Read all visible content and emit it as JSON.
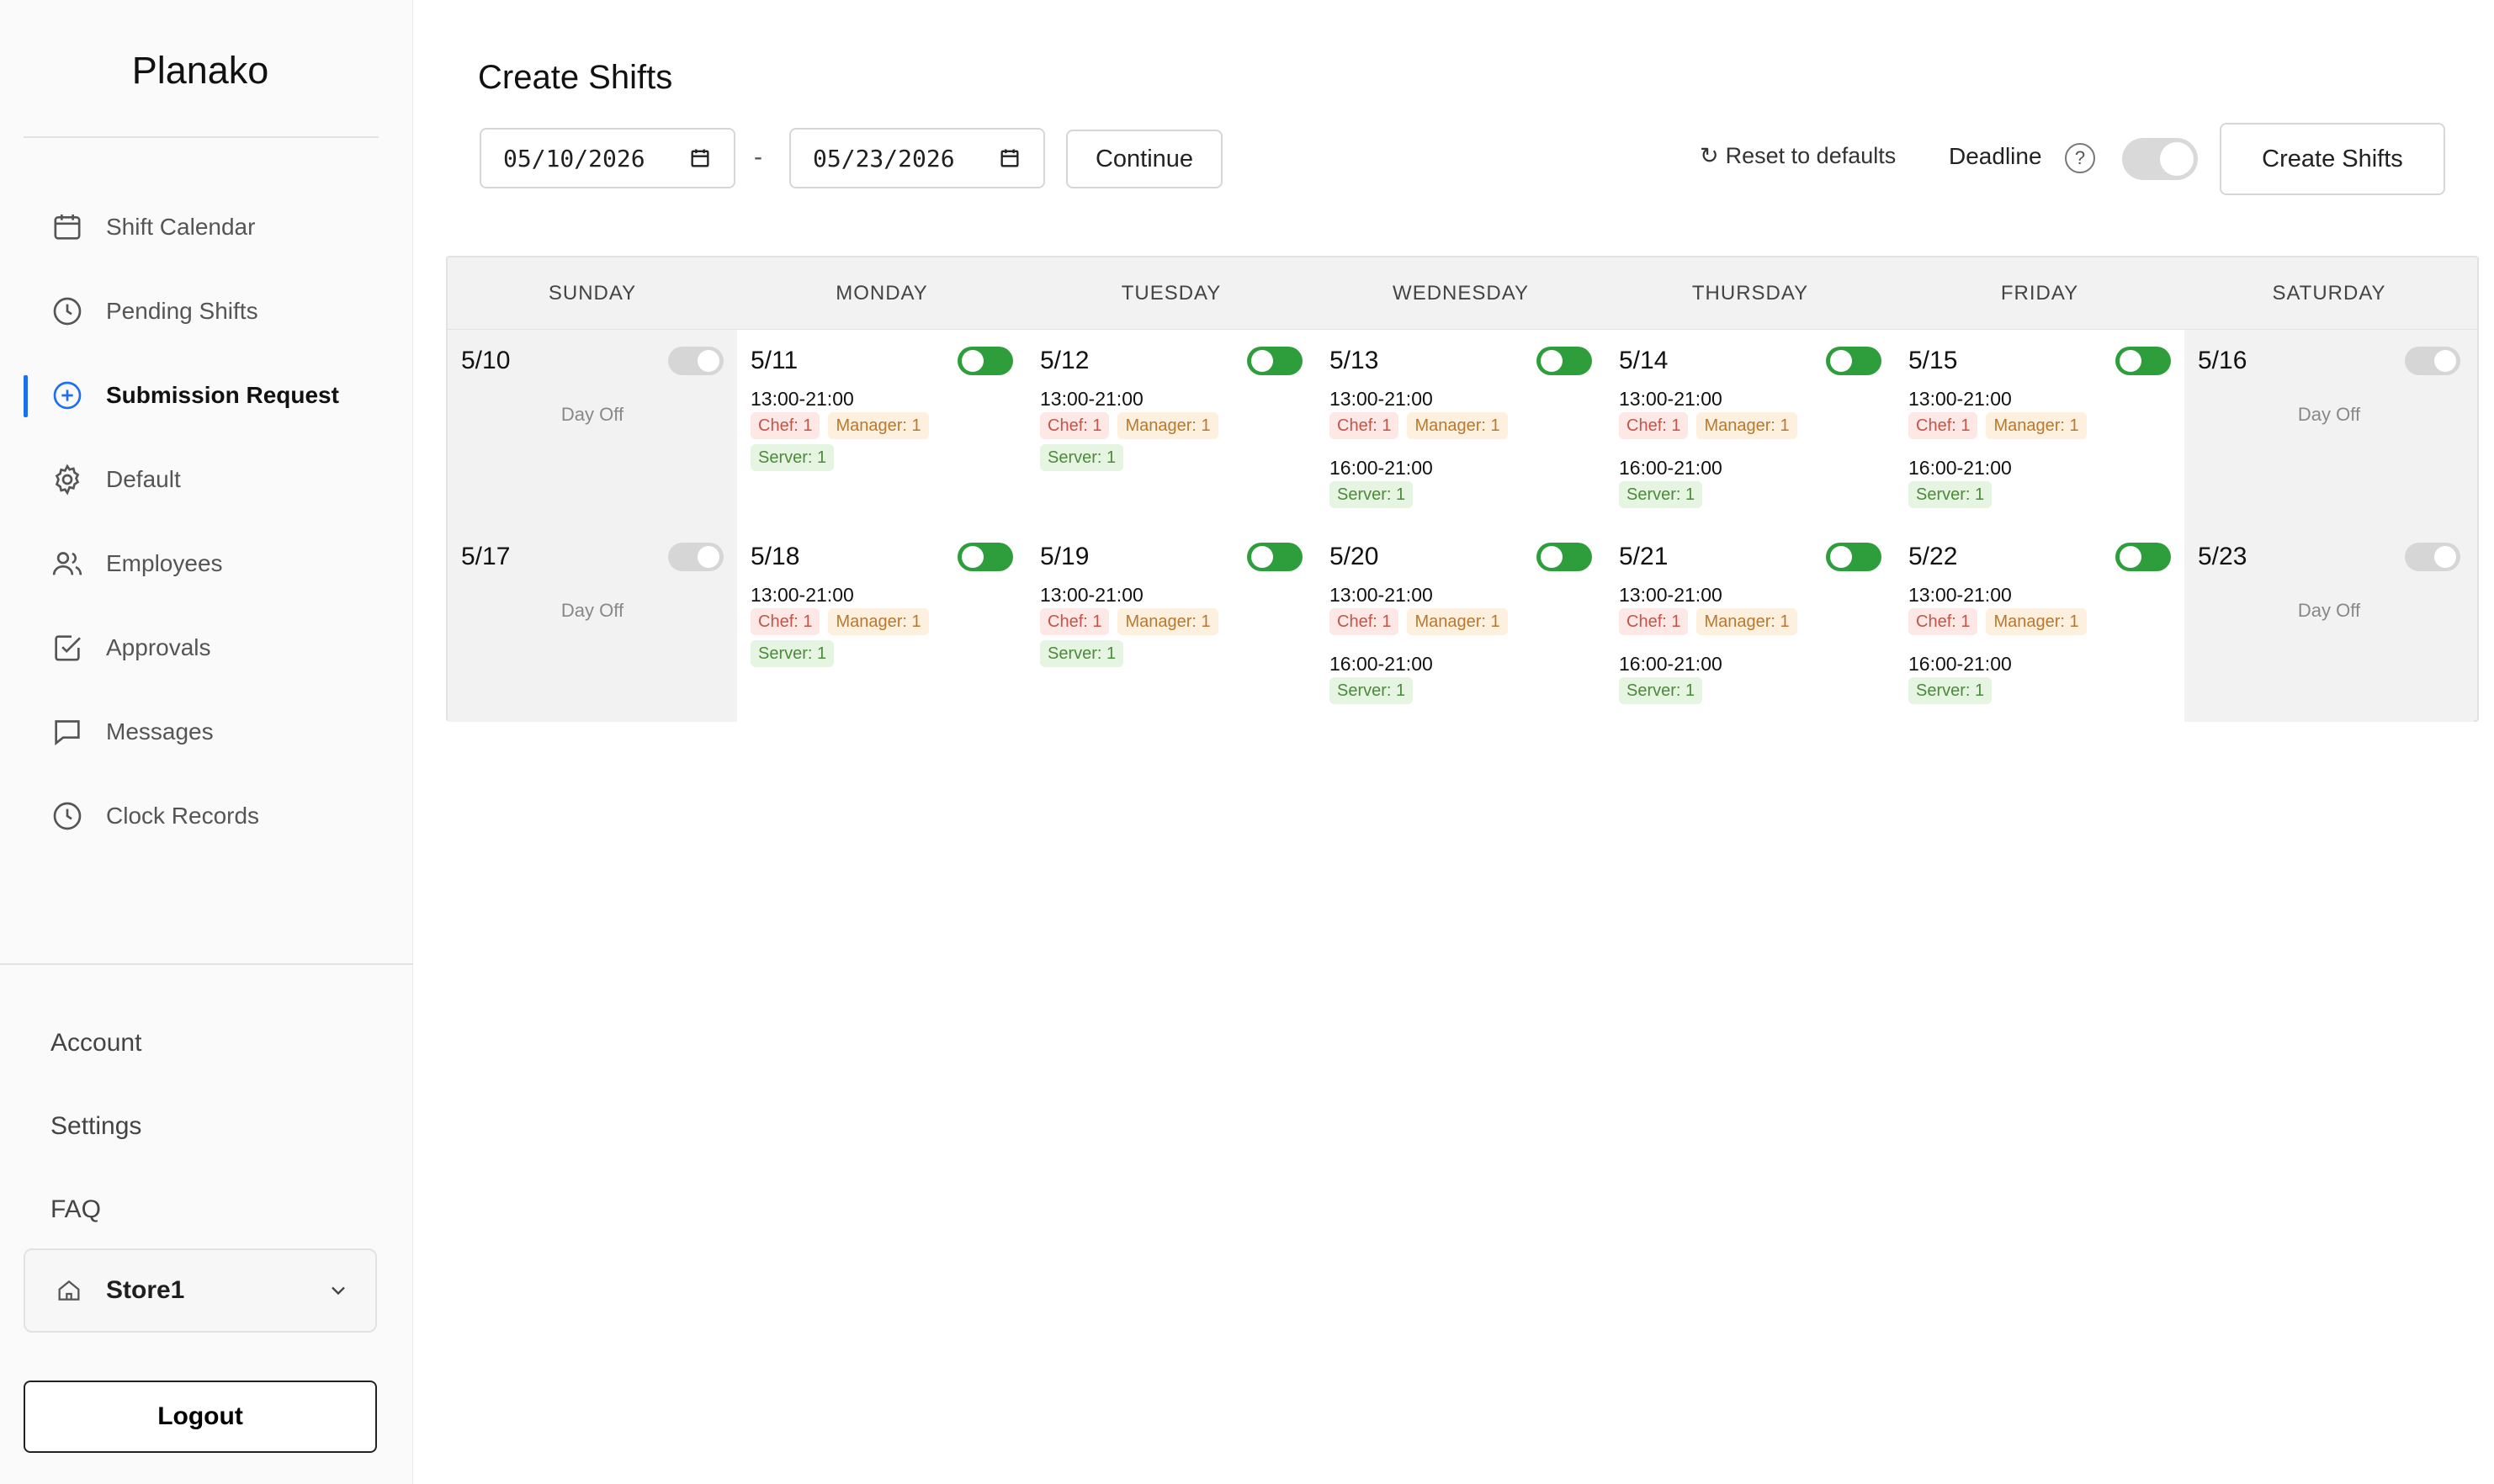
{
  "app": {
    "logo": "Planako"
  },
  "sidebar": {
    "nav": [
      {
        "label": "Shift Calendar",
        "icon": "calendar-icon",
        "active": false
      },
      {
        "label": "Pending Shifts",
        "icon": "clock-icon",
        "active": false
      },
      {
        "label": "Submission Request",
        "icon": "plus-circle-icon",
        "active": true
      },
      {
        "label": "Default",
        "icon": "gear-icon",
        "active": false
      },
      {
        "label": "Employees",
        "icon": "users-icon",
        "active": false
      },
      {
        "label": "Approvals",
        "icon": "checkbox-icon",
        "active": false
      },
      {
        "label": "Messages",
        "icon": "message-icon",
        "active": false
      },
      {
        "label": "Clock Records",
        "icon": "clock-icon",
        "active": false
      }
    ],
    "bottom_links": [
      "Account",
      "Settings",
      "FAQ"
    ],
    "store": {
      "label": "Store1",
      "icon": "home-icon"
    },
    "logout": "Logout"
  },
  "main": {
    "title": "Create Shifts",
    "start_date": "05/10/2026",
    "date_separator": "-",
    "end_date": "05/23/2026",
    "continue_label": "Continue",
    "reset_label": "Reset to defaults",
    "deadline_label": "Deadline",
    "help_symbol": "?",
    "deadline_enabled": false,
    "create_label": "Create Shifts"
  },
  "calendar": {
    "weekdays": [
      "SUNDAY",
      "MONDAY",
      "TUESDAY",
      "WEDNESDAY",
      "THURSDAY",
      "FRIDAY",
      "SATURDAY"
    ],
    "day_off_label": "Day Off",
    "weeks": [
      [
        {
          "date": "5/10",
          "enabled": false,
          "shifts": []
        },
        {
          "date": "5/11",
          "enabled": true,
          "shifts": [
            {
              "time": "13:00-21:00",
              "roles": [
                {
                  "label": "Chef: 1",
                  "type": "chef"
                },
                {
                  "label": "Manager: 1",
                  "type": "manager"
                },
                {
                  "label": "Server: 1",
                  "type": "server"
                }
              ]
            }
          ]
        },
        {
          "date": "5/12",
          "enabled": true,
          "shifts": [
            {
              "time": "13:00-21:00",
              "roles": [
                {
                  "label": "Chef: 1",
                  "type": "chef"
                },
                {
                  "label": "Manager: 1",
                  "type": "manager"
                },
                {
                  "label": "Server: 1",
                  "type": "server"
                }
              ]
            }
          ]
        },
        {
          "date": "5/13",
          "enabled": true,
          "shifts": [
            {
              "time": "13:00-21:00",
              "roles": [
                {
                  "label": "Chef: 1",
                  "type": "chef"
                },
                {
                  "label": "Manager: 1",
                  "type": "manager"
                }
              ]
            },
            {
              "time": "16:00-21:00",
              "roles": [
                {
                  "label": "Server: 1",
                  "type": "server"
                }
              ]
            }
          ]
        },
        {
          "date": "5/14",
          "enabled": true,
          "shifts": [
            {
              "time": "13:00-21:00",
              "roles": [
                {
                  "label": "Chef: 1",
                  "type": "chef"
                },
                {
                  "label": "Manager: 1",
                  "type": "manager"
                }
              ]
            },
            {
              "time": "16:00-21:00",
              "roles": [
                {
                  "label": "Server: 1",
                  "type": "server"
                }
              ]
            }
          ]
        },
        {
          "date": "5/15",
          "enabled": true,
          "shifts": [
            {
              "time": "13:00-21:00",
              "roles": [
                {
                  "label": "Chef: 1",
                  "type": "chef"
                },
                {
                  "label": "Manager: 1",
                  "type": "manager"
                }
              ]
            },
            {
              "time": "16:00-21:00",
              "roles": [
                {
                  "label": "Server: 1",
                  "type": "server"
                }
              ]
            }
          ]
        },
        {
          "date": "5/16",
          "enabled": false,
          "shifts": []
        }
      ],
      [
        {
          "date": "5/17",
          "enabled": false,
          "shifts": []
        },
        {
          "date": "5/18",
          "enabled": true,
          "shifts": [
            {
              "time": "13:00-21:00",
              "roles": [
                {
                  "label": "Chef: 1",
                  "type": "chef"
                },
                {
                  "label": "Manager: 1",
                  "type": "manager"
                },
                {
                  "label": "Server: 1",
                  "type": "server"
                }
              ]
            }
          ]
        },
        {
          "date": "5/19",
          "enabled": true,
          "shifts": [
            {
              "time": "13:00-21:00",
              "roles": [
                {
                  "label": "Chef: 1",
                  "type": "chef"
                },
                {
                  "label": "Manager: 1",
                  "type": "manager"
                },
                {
                  "label": "Server: 1",
                  "type": "server"
                }
              ]
            }
          ]
        },
        {
          "date": "5/20",
          "enabled": true,
          "shifts": [
            {
              "time": "13:00-21:00",
              "roles": [
                {
                  "label": "Chef: 1",
                  "type": "chef"
                },
                {
                  "label": "Manager: 1",
                  "type": "manager"
                }
              ]
            },
            {
              "time": "16:00-21:00",
              "roles": [
                {
                  "label": "Server: 1",
                  "type": "server"
                }
              ]
            }
          ]
        },
        {
          "date": "5/21",
          "enabled": true,
          "shifts": [
            {
              "time": "13:00-21:00",
              "roles": [
                {
                  "label": "Chef: 1",
                  "type": "chef"
                },
                {
                  "label": "Manager: 1",
                  "type": "manager"
                }
              ]
            },
            {
              "time": "16:00-21:00",
              "roles": [
                {
                  "label": "Server: 1",
                  "type": "server"
                }
              ]
            }
          ]
        },
        {
          "date": "5/22",
          "enabled": true,
          "shifts": [
            {
              "time": "13:00-21:00",
              "roles": [
                {
                  "label": "Chef: 1",
                  "type": "chef"
                },
                {
                  "label": "Manager: 1",
                  "type": "manager"
                }
              ]
            },
            {
              "time": "16:00-21:00",
              "roles": [
                {
                  "label": "Server: 1",
                  "type": "server"
                }
              ]
            }
          ]
        },
        {
          "date": "5/23",
          "enabled": false,
          "shifts": []
        }
      ]
    ]
  },
  "colors": {
    "accent": "#1e6ff0",
    "toggle_on": "#2e9e3c",
    "toggle_off": "#d6d6d6",
    "chef_badge": "#fde8e6",
    "manager_badge": "#fdf0de",
    "server_badge": "#e6f4e2"
  }
}
